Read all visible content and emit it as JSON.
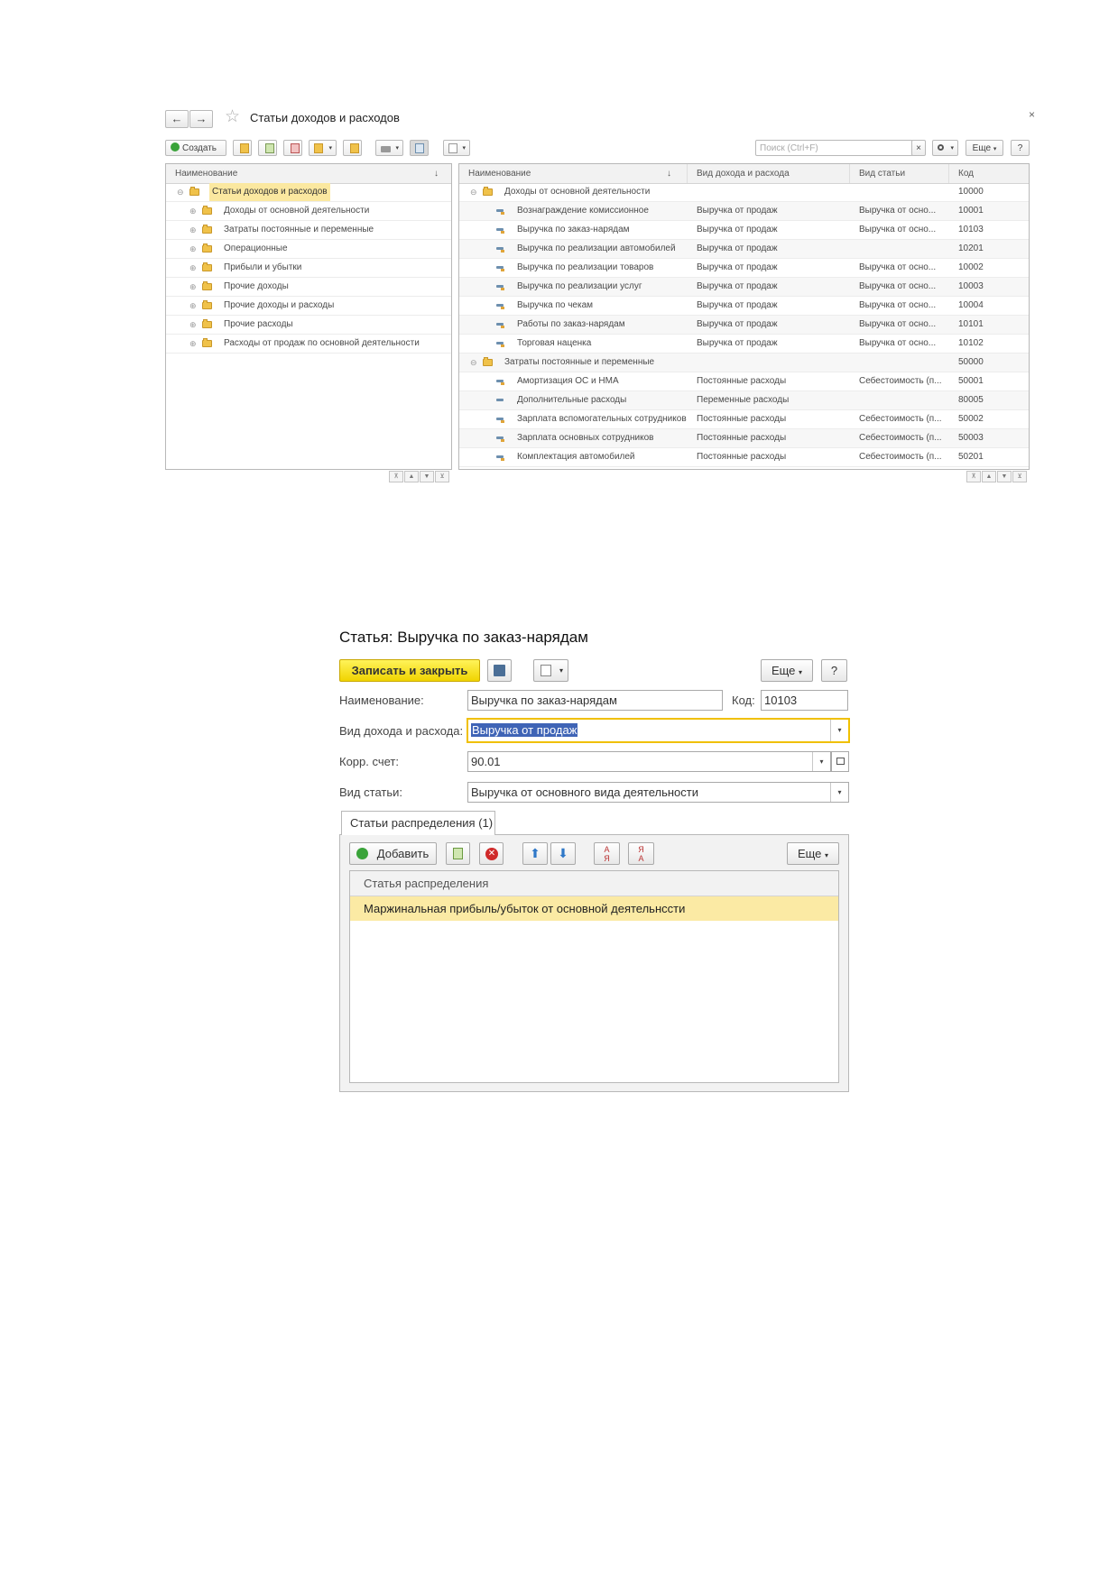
{
  "list_window": {
    "title": "Статьи доходов и расходов",
    "close_glyph": "×",
    "back_glyph": "←",
    "forward_glyph": "→",
    "star_glyph": "☆",
    "toolbar": {
      "create_label": "Создать",
      "search_placeholder": "Поиск (Ctrl+F)",
      "search_clear_glyph": "×",
      "more_label": "Еще",
      "help_label": "?"
    },
    "tree": {
      "header": "Наименование",
      "sort_glyph": "↓",
      "root": "Статьи доходов и расходов",
      "root_expander": "⊖",
      "child_expander": "⊕",
      "items": [
        "Доходы от основной деятельности",
        "Затраты постоянные и переменные",
        "Операционные",
        "Прибыли и убытки",
        "Прочие доходы",
        "Прочие доходы и расходы",
        "Прочие расходы",
        "Расходы от продаж по основной деятельности"
      ]
    },
    "grid": {
      "columns": [
        "Наименование",
        "Вид дохода и расхода",
        "Вид статьи",
        "Код"
      ],
      "sort_glyph": "↓",
      "group_expander": "⊖",
      "rows": [
        {
          "group": true,
          "name": "Доходы от основной деятельности",
          "kind": "",
          "type": "",
          "code": "10000"
        },
        {
          "group": false,
          "icon": "y",
          "name": "Вознаграждение комиссионное",
          "kind": "Выручка от продаж",
          "type": "Выручка от осно...",
          "code": "10001"
        },
        {
          "group": false,
          "icon": "y",
          "name": "Выручка по заказ-нарядам",
          "kind": "Выручка от продаж",
          "type": "Выручка от осно...",
          "code": "10103"
        },
        {
          "group": false,
          "icon": "y",
          "name": "Выручка по реализации автомобилей",
          "kind": "Выручка от продаж",
          "type": "",
          "code": "10201"
        },
        {
          "group": false,
          "icon": "y",
          "name": "Выручка по реализации товаров",
          "kind": "Выручка от продаж",
          "type": "Выручка от осно...",
          "code": "10002"
        },
        {
          "group": false,
          "icon": "y",
          "name": "Выручка по реализации услуг",
          "kind": "Выручка от продаж",
          "type": "Выручка от осно...",
          "code": "10003"
        },
        {
          "group": false,
          "icon": "y",
          "name": "Выручка по чекам",
          "kind": "Выручка от продаж",
          "type": "Выручка от осно...",
          "code": "10004"
        },
        {
          "group": false,
          "icon": "y",
          "name": "Работы по заказ-нарядам",
          "kind": "Выручка от продаж",
          "type": "Выручка от осно...",
          "code": "10101"
        },
        {
          "group": false,
          "icon": "y",
          "name": "Торговая наценка",
          "kind": "Выручка от продаж",
          "type": "Выручка от осно...",
          "code": "10102"
        },
        {
          "group": true,
          "name": "Затраты постоянные и переменные",
          "kind": "",
          "type": "",
          "code": "50000"
        },
        {
          "group": false,
          "icon": "y",
          "name": "Амортизация ОС и НМА",
          "kind": "Постоянные расходы",
          "type": "Себестоимость (п...",
          "code": "50001"
        },
        {
          "group": false,
          "icon": "b",
          "name": "Дополнительные расходы",
          "kind": "Переменные расходы",
          "type": "",
          "code": "80005"
        },
        {
          "group": false,
          "icon": "y",
          "name": "Зарплата вспомогательных сотрудников",
          "kind": "Постоянные расходы",
          "type": "Себестоимость (п...",
          "code": "50002"
        },
        {
          "group": false,
          "icon": "y",
          "name": "Зарплата основных сотрудников",
          "kind": "Постоянные расходы",
          "type": "Себестоимость (п...",
          "code": "50003"
        },
        {
          "group": false,
          "icon": "y",
          "name": "Комплектация автомобилей",
          "kind": "Постоянные расходы",
          "type": "Себестоимость (п...",
          "code": "50201"
        }
      ]
    },
    "pager": [
      "⊼",
      "▲",
      "▼",
      "⊻"
    ]
  },
  "item_form": {
    "title": "Статья: Выручка по заказ-нарядам",
    "save_close_label": "Записать и закрыть",
    "more_label": "Еще",
    "help_label": "?",
    "fields": {
      "name_label": "Наименование:",
      "name_value": "Выручка по заказ-нарядам",
      "code_label": "Код:",
      "code_value": "10103",
      "kind_label": "Вид дохода и расхода:",
      "kind_value": "Выручка от продаж",
      "account_label": "Корр. счет:",
      "account_value": "90.01",
      "type_label": "Вид статьи:",
      "type_value": "Выручка от основного вида деятельности"
    },
    "dropdown_glyph": "▾",
    "tab_label": "Статьи распределения (1)",
    "tab_toolbar": {
      "add_label": "Добавить",
      "more_label": "Еще"
    },
    "table": {
      "header": "Статья распределения",
      "rows": [
        "Маржинальная прибыль/убыток от основной деятельнсcти"
      ]
    }
  }
}
